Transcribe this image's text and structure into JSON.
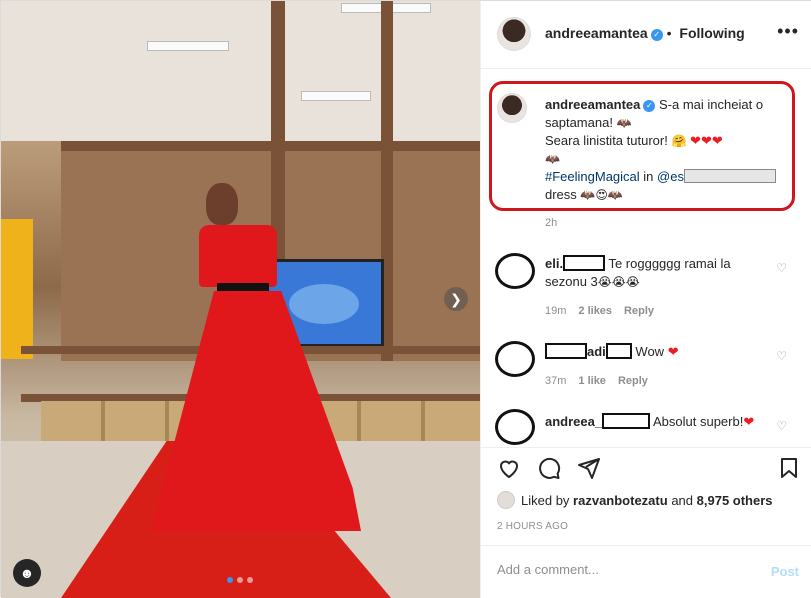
{
  "post": {
    "username": "andreeamantea",
    "follow_label": "Following",
    "more_label": "•••"
  },
  "caption": {
    "username": "andreeamantea",
    "line1": "S-a mai incheiat o saptamana!",
    "line2": "Seara linistita tuturor!",
    "hashtag": "#FeelingMagical",
    "in_word": "in",
    "mention_prefix": "@es",
    "tail": "dress",
    "time": "2h"
  },
  "comments": [
    {
      "user_prefix": "eli.",
      "text": "Te rogggggg ramai la sezonu 3",
      "time": "19m",
      "likes": "2 likes",
      "reply": "Reply"
    },
    {
      "user_mid": "adi",
      "text": "Wow",
      "time": "37m",
      "likes": "1 like",
      "reply": "Reply"
    },
    {
      "user_prefix": "andreea_",
      "text": "Absolut superb!"
    }
  ],
  "liked": {
    "prefix": "Liked by",
    "user": "razvanbotezatu",
    "and": "and",
    "count": "8,975 others"
  },
  "posted_ago": "2 HOURS AGO",
  "add_comment": {
    "placeholder": "Add a comment...",
    "post_label": "Post"
  },
  "carousel": {
    "slide_count": 3,
    "active_slide": 1
  },
  "colors": {
    "accent": "#3897f0",
    "heart": "#ed1c24",
    "highlight": "#d0161c",
    "link": "#00376b"
  }
}
